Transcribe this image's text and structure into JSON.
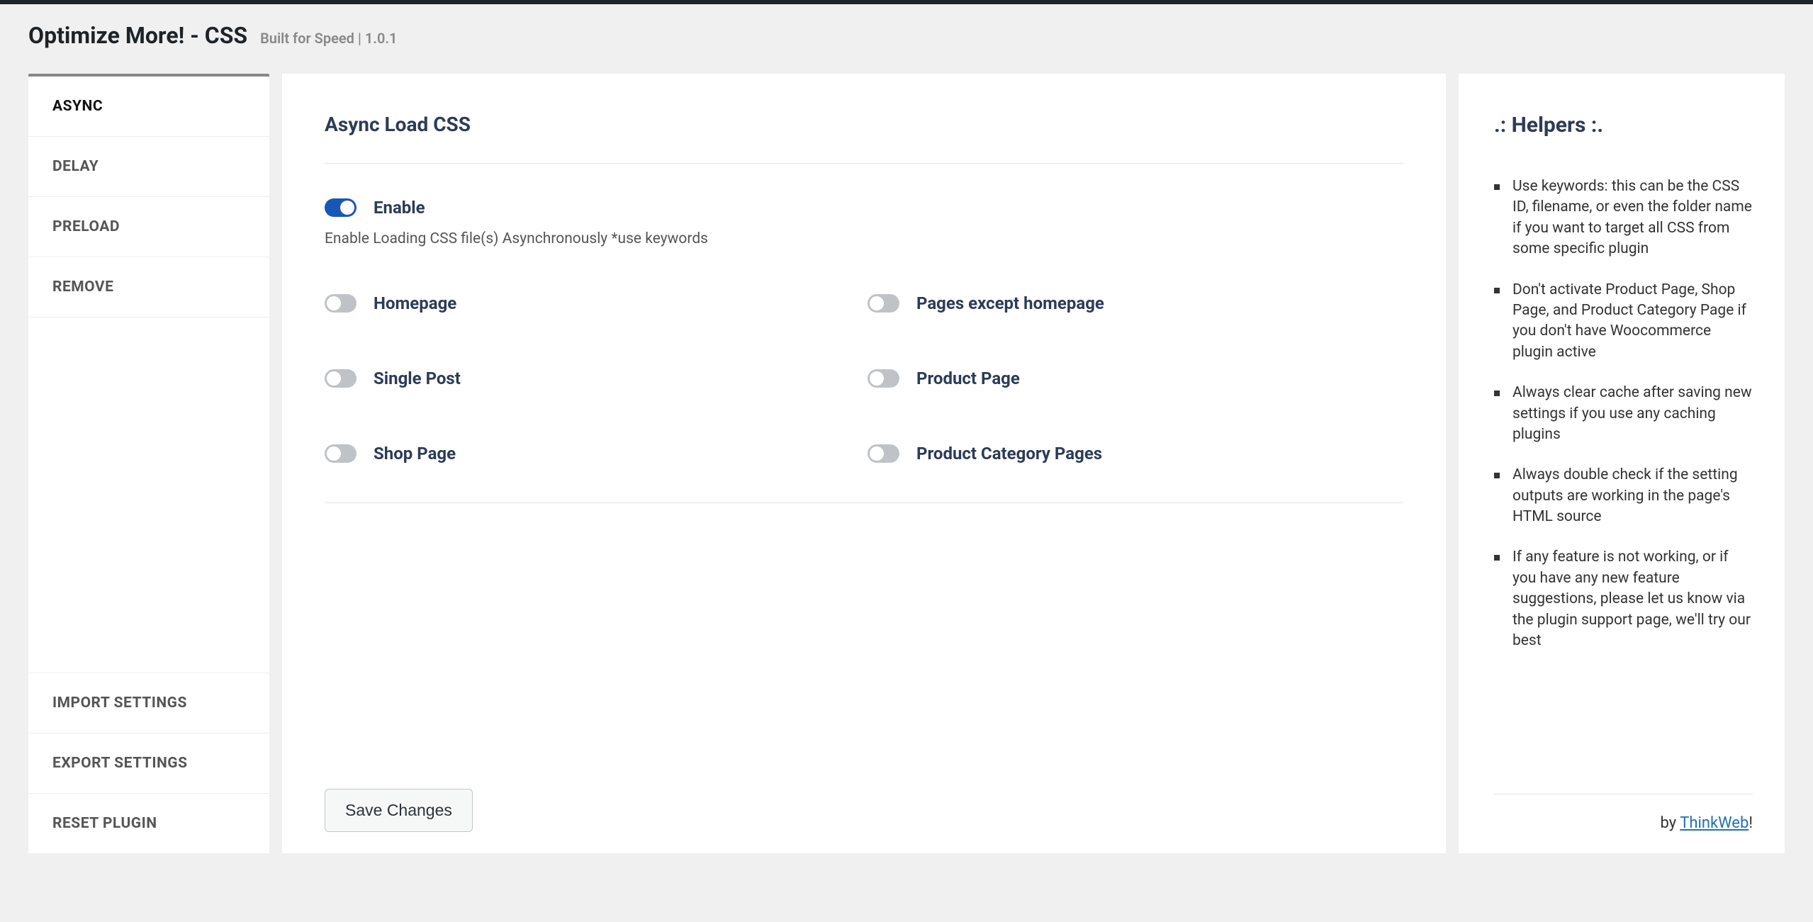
{
  "header": {
    "title": "Optimize More! - CSS",
    "meta": "Built for Speed | 1.0.1"
  },
  "sidebar": {
    "tabs": [
      {
        "label": "ASYNC",
        "active": true
      },
      {
        "label": "DELAY",
        "active": false
      },
      {
        "label": "PRELOAD",
        "active": false
      },
      {
        "label": "REMOVE",
        "active": false
      }
    ],
    "bottom": [
      {
        "label": "IMPORT SETTINGS"
      },
      {
        "label": "EXPORT SETTINGS"
      },
      {
        "label": "RESET PLUGIN"
      }
    ]
  },
  "main": {
    "title": "Async Load CSS",
    "enable": {
      "label": "Enable",
      "help": "Enable Loading CSS file(s) Asynchronously *use keywords",
      "on": true
    },
    "options": [
      {
        "label": "Homepage",
        "on": false
      },
      {
        "label": "Pages except homepage",
        "on": false
      },
      {
        "label": "Single Post",
        "on": false
      },
      {
        "label": "Product Page",
        "on": false
      },
      {
        "label": "Shop Page",
        "on": false
      },
      {
        "label": "Product Category Pages",
        "on": false
      }
    ],
    "save_label": "Save Changes"
  },
  "helpers": {
    "title": ".: Helpers :.",
    "items": [
      "Use keywords: this can be the CSS ID, filename, or even the folder name if you want to target all CSS from some specific plugin",
      "Don't activate Product Page, Shop Page, and Product Category Page if you don't have Woocommerce plugin active",
      "Always clear cache after saving new settings if you use any caching plugins",
      "Always double check if the setting outputs are working in the page's HTML source",
      "If any feature is not working, or if you have any new feature suggestions, please let us know via the plugin support page, we'll try our best"
    ],
    "footer_prefix": "by ",
    "footer_link": "ThinkWeb",
    "footer_suffix": "!"
  }
}
